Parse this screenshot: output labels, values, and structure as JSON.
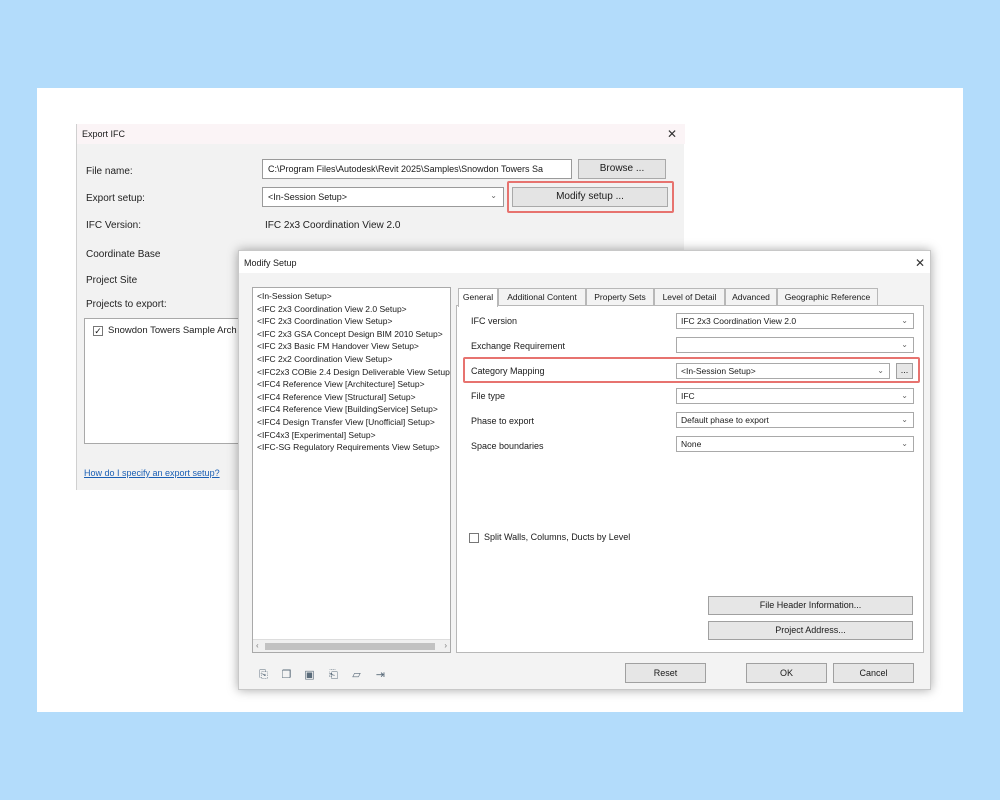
{
  "export_dialog": {
    "title": "Export IFC",
    "file_name_label": "File name:",
    "file_name_value": "C:\\Program Files\\Autodesk\\Revit 2025\\Samples\\Snowdon Towers Sa",
    "browse_label": "Browse ...",
    "export_setup_label": "Export setup:",
    "export_setup_value": "<In-Session Setup>",
    "modify_setup_label": "Modify setup ...",
    "ifc_version_label": "IFC Version:",
    "ifc_version_value": "IFC 2x3 Coordination View 2.0",
    "coordinate_base_label": "Coordinate Base",
    "project_site_label": "Project Site",
    "projects_to_export_label": "Projects to export:",
    "project_item": "Snowdon Towers Sample Arch",
    "help_link": "How do I specify an export setup?",
    "close_glyph": "✕"
  },
  "modify_dialog": {
    "title": "Modify Setup",
    "close_glyph": "✕",
    "setups": [
      "<In-Session Setup>",
      "<IFC 2x3 Coordination View 2.0 Setup>",
      "<IFC 2x3 Coordination View Setup>",
      "<IFC 2x3 GSA Concept Design BIM 2010 Setup>",
      "<IFC 2x3 Basic FM Handover View Setup>",
      "<IFC 2x2 Coordination View Setup>",
      "<IFC2x3 COBie 2.4 Design Deliverable View Setup>",
      "<IFC4 Reference View [Architecture] Setup>",
      "<IFC4 Reference View [Structural] Setup>",
      "<IFC4 Reference View [BuildingService] Setup>",
      "<IFC4 Design Transfer View [Unofficial] Setup>",
      "<IFC4x3 [Experimental] Setup>",
      "<IFC-SG Regulatory Requirements View Setup>"
    ],
    "tabs": [
      "General",
      "Additional Content",
      "Property Sets",
      "Level of Detail",
      "Advanced",
      "Geographic Reference"
    ],
    "general": {
      "ifc_version_label": "IFC version",
      "ifc_version_value": "IFC 2x3 Coordination View 2.0",
      "exchange_requirement_label": "Exchange Requirement",
      "exchange_requirement_value": "",
      "category_mapping_label": "Category Mapping",
      "category_mapping_value": "<In-Session Setup>",
      "file_type_label": "File type",
      "file_type_value": "IFC",
      "phase_label": "Phase to export",
      "phase_value": "Default phase to export",
      "space_boundaries_label": "Space boundaries",
      "space_boundaries_value": "None",
      "split_label": "Split Walls, Columns, Ducts by Level",
      "file_header_label": "File Header Information...",
      "project_address_label": "Project Address..."
    },
    "reset_label": "Reset",
    "ok_label": "OK",
    "cancel_label": "Cancel",
    "ellipsis_label": "..."
  },
  "colors": {
    "background": "#b3dcfb",
    "highlight": "#e7736f",
    "link": "#1a5fb4"
  }
}
